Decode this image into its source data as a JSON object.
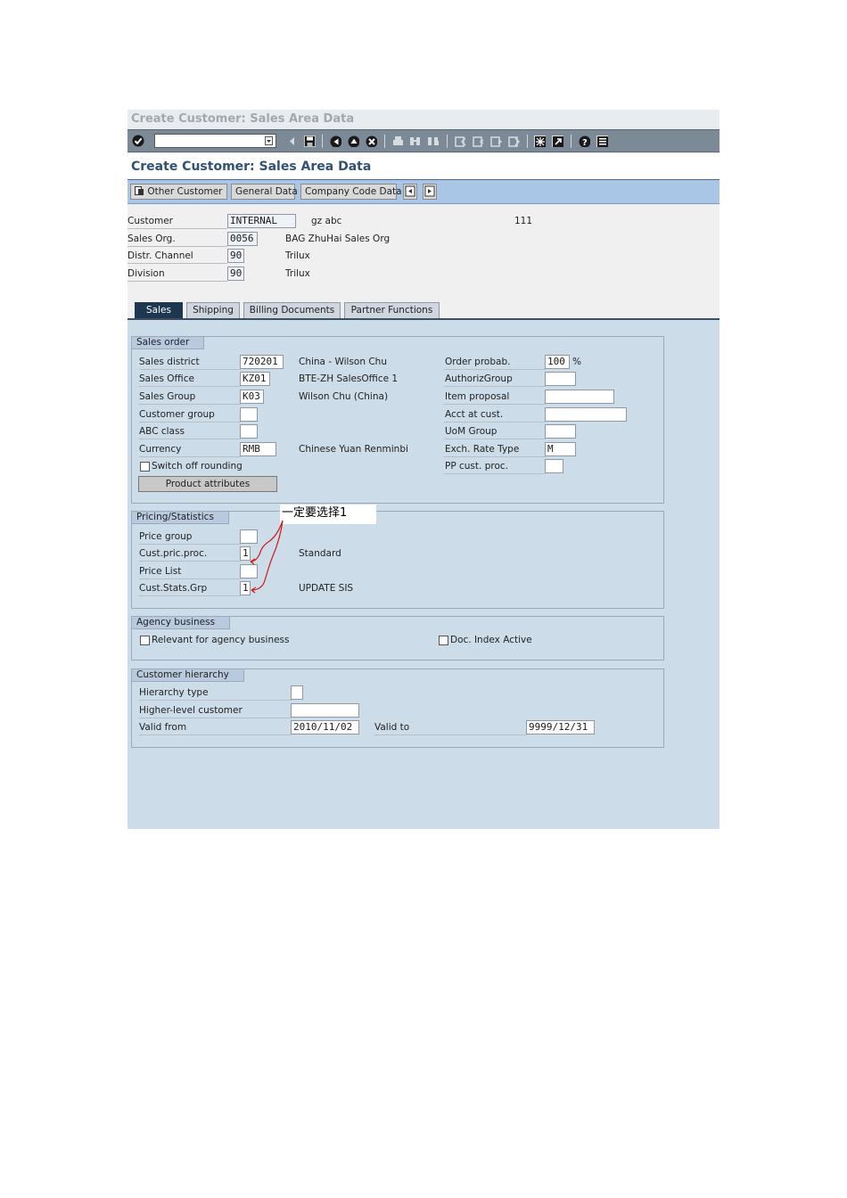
{
  "window_title": "Create Customer: Sales Area Data",
  "screen_title": "Create Customer: Sales Area Data",
  "command_field": {
    "value": ""
  },
  "toolbar_icons": [
    "enter-icon",
    "command-dropdown-icon",
    "back-arrow-icon",
    "save-icon",
    "back-icon",
    "exit-icon",
    "cancel-icon",
    "print-icon",
    "find-icon",
    "find-next-icon",
    "first-page-icon",
    "previous-page-icon",
    "next-page-icon",
    "last-page-icon",
    "create-session-icon",
    "shortcut-icon",
    "help-icon",
    "layout-menu-icon"
  ],
  "app_toolbar": {
    "other_customer": "Other Customer",
    "general_data": "General Data",
    "company_code_data": "Company Code Data"
  },
  "header": {
    "customer": {
      "label": "Customer",
      "value": "INTERNAL",
      "desc": "gz abc",
      "extra": "111"
    },
    "sales_org": {
      "label": "Sales Org.",
      "value": "0056",
      "desc": "BAG ZhuHai Sales Org"
    },
    "distr_channel": {
      "label": "Distr. Channel",
      "value": "90",
      "desc": "Trilux"
    },
    "division": {
      "label": "Division",
      "value": "90",
      "desc": "Trilux"
    }
  },
  "tabs": [
    {
      "label": "Sales",
      "active": true
    },
    {
      "label": "Shipping",
      "active": false
    },
    {
      "label": "Billing Documents",
      "active": false
    },
    {
      "label": "Partner Functions",
      "active": false
    }
  ],
  "sales_order": {
    "title": "Sales order",
    "sales_district": {
      "label": "Sales district",
      "value": "720201",
      "desc": "China - Wilson Chu"
    },
    "sales_office": {
      "label": "Sales Office",
      "value": "KZ01",
      "desc": "BTE-ZH SalesOffice 1"
    },
    "sales_group": {
      "label": "Sales Group",
      "value": "K03",
      "desc": "Wilson Chu (China)"
    },
    "customer_group": {
      "label": "Customer group",
      "value": ""
    },
    "abc_class": {
      "label": "ABC class",
      "value": ""
    },
    "currency": {
      "label": "Currency",
      "value": "RMB",
      "desc": "Chinese Yuan Renminbi"
    },
    "switch_off_rounding": {
      "label": "Switch off rounding",
      "checked": false
    },
    "product_attributes": "Product attributes",
    "order_probab": {
      "label": "Order probab.",
      "value": "100",
      "unit": "%"
    },
    "authoriz_group": {
      "label": "AuthorizGroup",
      "value": ""
    },
    "item_proposal": {
      "label": "Item proposal",
      "value": ""
    },
    "acct_at_cust": {
      "label": "Acct at cust.",
      "value": ""
    },
    "uom_group": {
      "label": "UoM Group",
      "value": ""
    },
    "exch_rate_type": {
      "label": "Exch. Rate Type",
      "value": "M"
    },
    "pp_cust_proc": {
      "label": "PP cust. proc.",
      "value": ""
    }
  },
  "pricing": {
    "title": "Pricing/Statistics",
    "annotation": "一定要选择1",
    "price_group": {
      "label": "Price group",
      "value": ""
    },
    "cust_pric_proc": {
      "label": "Cust.pric.proc.",
      "value": "1",
      "desc": "Standard"
    },
    "price_list": {
      "label": "Price List",
      "value": ""
    },
    "cust_stats_grp": {
      "label": "Cust.Stats.Grp",
      "value": "1",
      "desc": "UPDATE SIS"
    }
  },
  "agency": {
    "title": "Agency business",
    "relevant": {
      "label": "Relevant for agency business",
      "checked": false
    },
    "doc_index": {
      "label": "Doc. Index Active",
      "checked": false
    }
  },
  "hierarchy": {
    "title": "Customer hierarchy",
    "hierarchy_type": {
      "label": "Hierarchy type",
      "value": ""
    },
    "higher_level": {
      "label": "Higher-level customer",
      "value": ""
    },
    "valid_from": {
      "label": "Valid from",
      "value": "2010/11/02"
    },
    "valid_to": {
      "label": "Valid to",
      "value": "9999/12/31"
    }
  },
  "colors": {
    "app_toolbar": "#a9c6e6",
    "content_bg": "#cddce9",
    "active_tab": "#1e3750",
    "title_text": "#2f5276",
    "annotation_ink": "#d01818"
  }
}
